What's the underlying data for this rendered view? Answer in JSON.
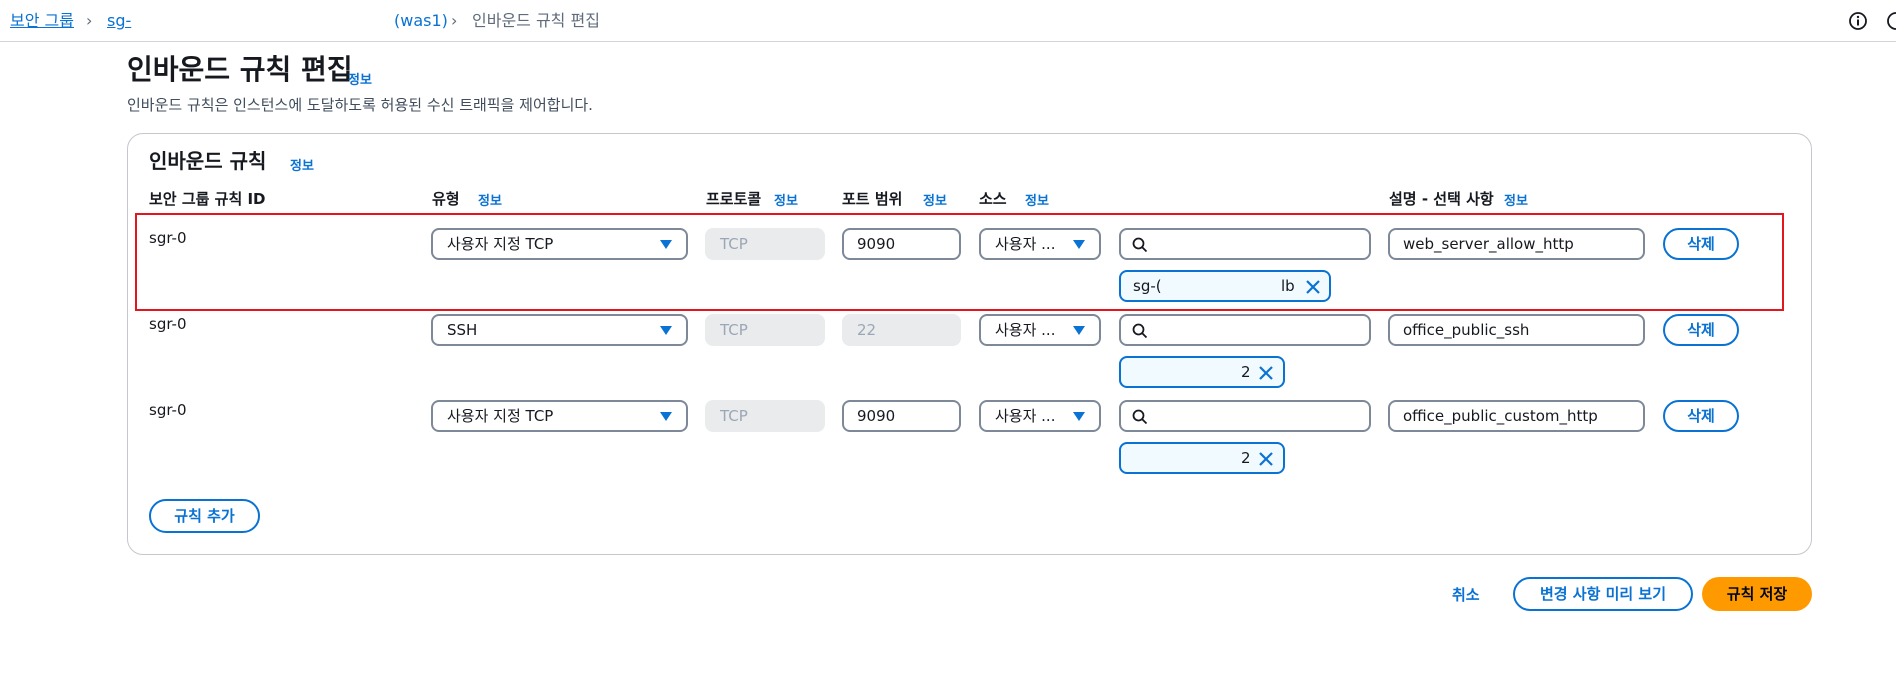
{
  "breadcrumb": {
    "root": "보안 그룹",
    "sg_prefix": "sg-",
    "sg_suffix": "(was1)",
    "current": "인바운드 규칙 편집"
  },
  "header": {
    "title": "인바운드 규칙 편집",
    "info": "정보",
    "description": "인바운드 규칙은 인스턴스에 도달하도록 허용된 수신 트래픽을 제어합니다."
  },
  "panel": {
    "title": "인바운드 규칙",
    "info": "정보",
    "columns": {
      "rule_id": "보안 그룹 규칙 ID",
      "type": "유형",
      "protocol": "프로토콜",
      "port": "포트 범위",
      "source": "소스",
      "description": "설명 - 선택 사항",
      "info": "정보"
    },
    "rules": [
      {
        "id": "sgr-0",
        "type": "사용자 지정 TCP",
        "protocol": "TCP",
        "port": "9090",
        "source": "사용자 ...",
        "search_value": "",
        "token_prefix": "sg-(",
        "token_suffix": "lb",
        "description": "web_server_allow_http",
        "delete": "삭제"
      },
      {
        "id": "sgr-0",
        "type": "SSH",
        "protocol": "TCP",
        "port": "22",
        "source": "사용자 ...",
        "search_value": "",
        "token_prefix": "",
        "token_suffix": "2",
        "description": "office_public_ssh",
        "delete": "삭제"
      },
      {
        "id": "sgr-0",
        "type": "사용자 지정 TCP",
        "protocol": "TCP",
        "port": "9090",
        "source": "사용자 ...",
        "search_value": "",
        "token_prefix": "",
        "token_suffix": "2",
        "description": "office_public_custom_http",
        "delete": "삭제"
      }
    ],
    "add_rule": "규칙 추가"
  },
  "footer": {
    "cancel": "취소",
    "preview": "변경 사항 미리 보기",
    "save": "규칙 저장"
  },
  "colors": {
    "link": "#0972d3",
    "primary": "#ff9900",
    "highlight": "#e3151d"
  }
}
